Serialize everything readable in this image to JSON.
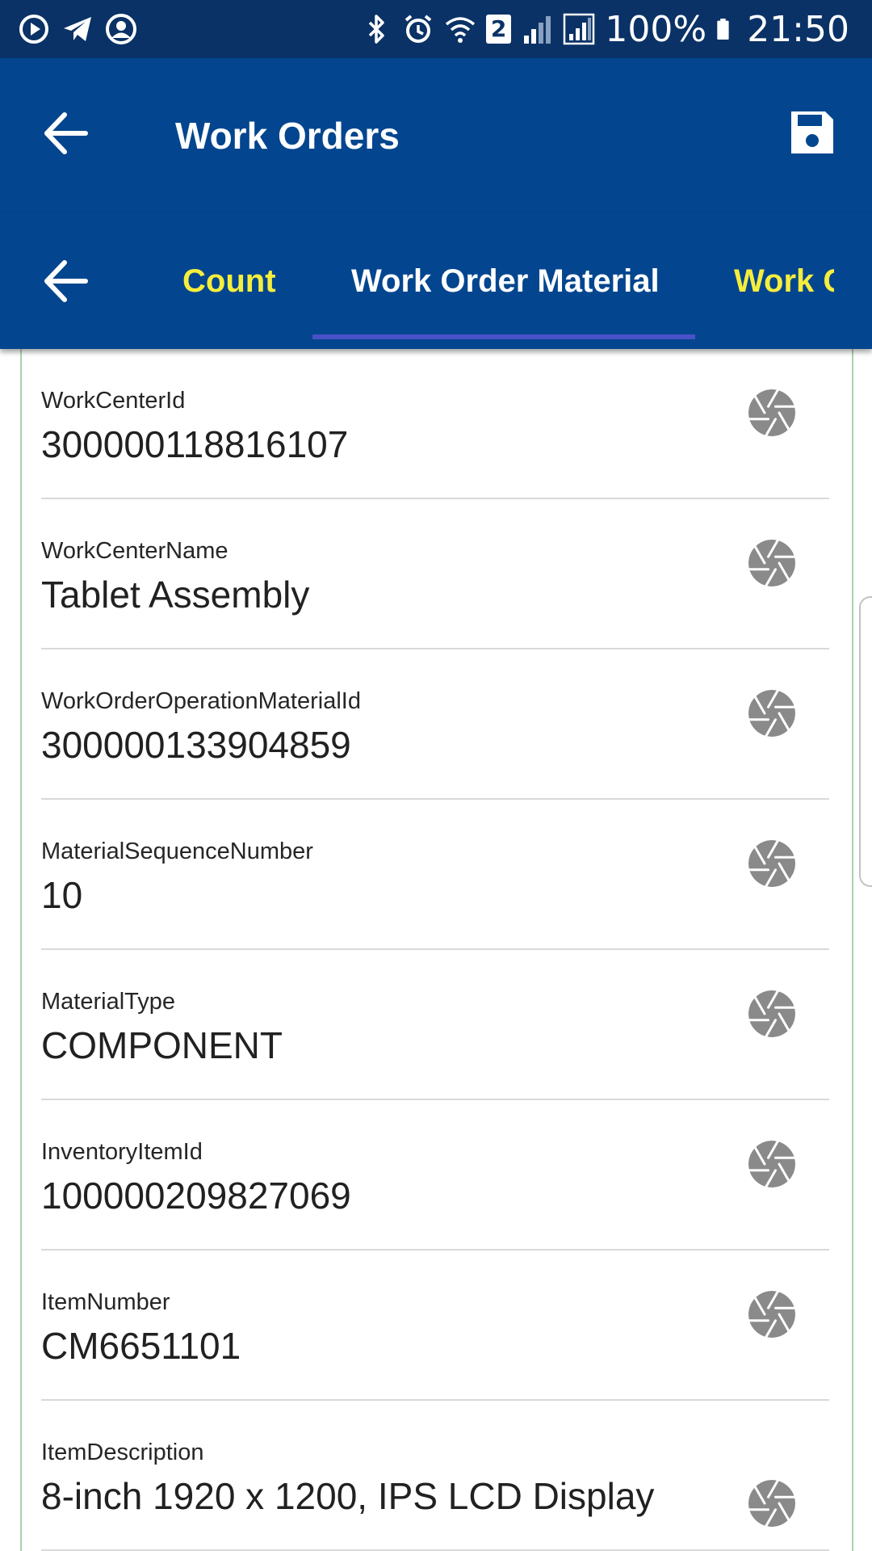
{
  "status_bar": {
    "battery_percent": "100%",
    "time": "21:50",
    "sim_slot": "2",
    "icons": [
      "video-call-icon",
      "telegram-icon",
      "account-icon",
      "bluetooth-icon",
      "alarm-icon",
      "wifi-icon",
      "signal-icon",
      "roaming-signal-icon",
      "battery-icon"
    ]
  },
  "app_bar": {
    "title": "Work Orders",
    "back_icon": "arrow-left-icon",
    "save_icon": "save-icon"
  },
  "tabs": {
    "back_icon": "arrow-left-icon",
    "items": [
      {
        "label": "Count",
        "active": false
      },
      {
        "label": "Work Order Material",
        "active": true
      },
      {
        "label": "Work C",
        "active": false
      }
    ],
    "active_color": "#ffffff",
    "inactive_color": "#f6ed3d",
    "indicator_color": "#4851c8"
  },
  "colors": {
    "app_bar": "#03468f",
    "status_bar": "#0a3266",
    "content_border": "#a9d2ad",
    "camera_icon": "#8a8a8a"
  },
  "fields": [
    {
      "label": "WorkCenterId",
      "value": "300000118816107"
    },
    {
      "label": "WorkCenterName",
      "value": "Tablet Assembly"
    },
    {
      "label": "WorkOrderOperationMaterialId",
      "value": "300000133904859"
    },
    {
      "label": "MaterialSequenceNumber",
      "value": "10"
    },
    {
      "label": "MaterialType",
      "value": "COMPONENT"
    },
    {
      "label": "InventoryItemId",
      "value": "100000209827069"
    },
    {
      "label": "ItemNumber",
      "value": "CM6651101"
    },
    {
      "label": "ItemDescription",
      "value": "8-inch 1920 x 1200, IPS LCD Display"
    }
  ],
  "field_action_icon": "camera-aperture-icon"
}
